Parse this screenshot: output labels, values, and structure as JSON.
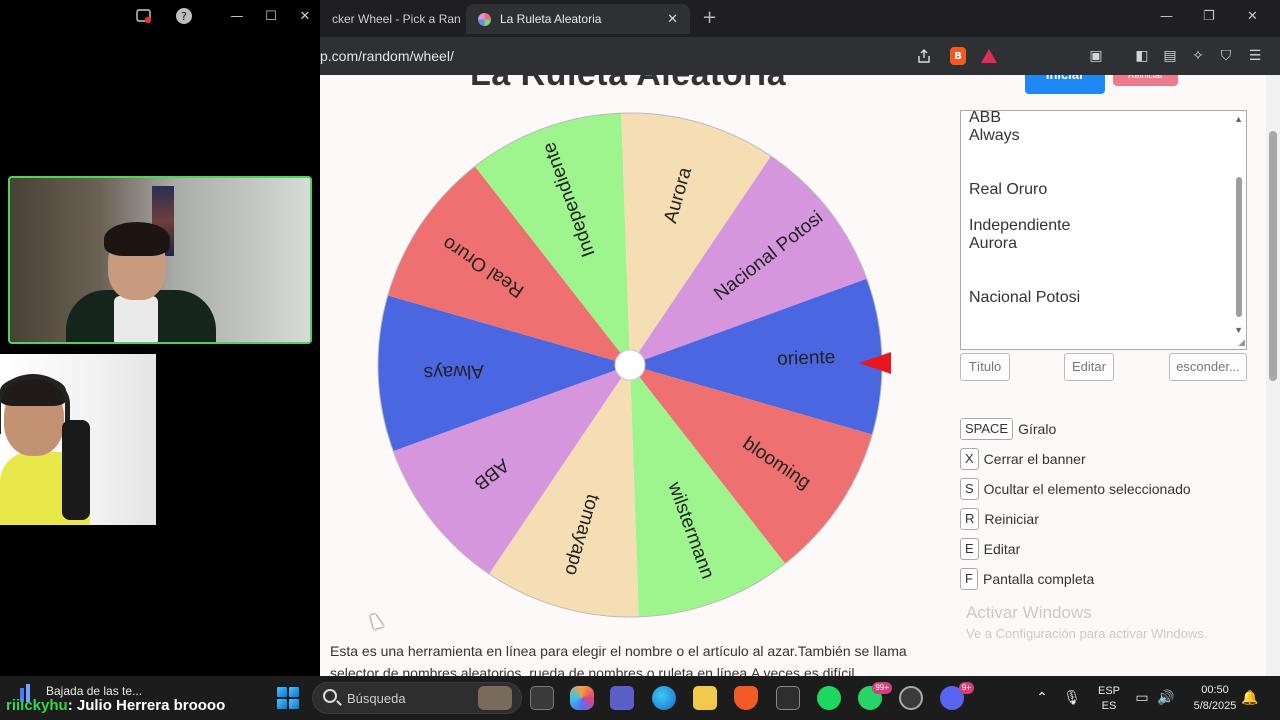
{
  "browser": {
    "tabs": [
      {
        "title": "cker Wheel - Pick a Rando"
      },
      {
        "title": "La Ruleta Aleatoria"
      }
    ],
    "url": "p.com/random/wheel/"
  },
  "page": {
    "title": "La Ruleta Aleatoria",
    "start_label": "Iniciar",
    "reset_label": "Reiniciar",
    "wheel": {
      "segments": [
        {
          "label": "Always",
          "color": "#4a66e0"
        },
        {
          "label": "Real Oruro",
          "color": "#ee7070"
        },
        {
          "label": "Independiente",
          "color": "#9ef58e"
        },
        {
          "label": "Aurora",
          "color": "#f5deb4"
        },
        {
          "label": "Nacional Potosi",
          "color": "#d596de"
        },
        {
          "label": "oriente",
          "color": "#4a66e0"
        },
        {
          "label": "blooming",
          "color": "#ee7070"
        },
        {
          "label": "wilstermann",
          "color": "#9ef58e"
        },
        {
          "label": "tomayapo",
          "color": "#f5deb4"
        },
        {
          "label": "ABB",
          "color": "#d596de"
        }
      ]
    },
    "entries": [
      "ABB",
      "Always",
      "",
      "",
      "Real Oruro",
      "",
      "Independiente",
      "Aurora",
      "",
      "",
      "Nacional Potosi"
    ],
    "buttons": {
      "title": "Título",
      "edit": "Editar",
      "hide": "esconder..."
    },
    "shortcuts": [
      {
        "key": "SPACE",
        "text": "Gíralo"
      },
      {
        "key": "X",
        "text": "Cerrar el banner"
      },
      {
        "key": "S",
        "text": "Ocultar el elemento seleccionado"
      },
      {
        "key": "R",
        "text": "Reiniciar"
      },
      {
        "key": "E",
        "text": "Editar"
      },
      {
        "key": "F",
        "text": "Pantalla completa"
      }
    ],
    "watermark": {
      "line1": "Activar Windows",
      "line2": "Ve a Configuración para activar Windows."
    },
    "description": "Esta es una herramienta en línea para elegir el nombre o el artículo al azar.También se llama selector de nombres aleatorios, rueda de nombres o ruleta en línea.A veces es difícil"
  },
  "taskbar": {
    "news": "Bajada de las te...",
    "overlay_name": "riiickyhu",
    "overlay_message": ": Julio Herrera broooo",
    "search_placeholder": "Búsqueda",
    "whatsapp_badge": "99+",
    "discord_badge": "9+",
    "lang_top": "ESP",
    "lang_bottom": "ES",
    "time": "00:50",
    "date": "5/8/2025"
  }
}
